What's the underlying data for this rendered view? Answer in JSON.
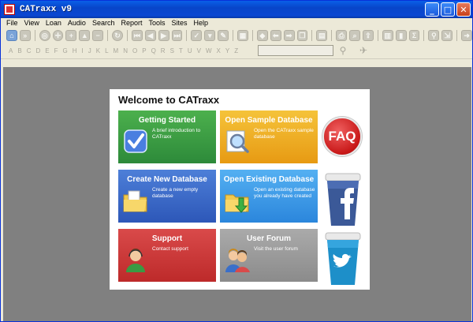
{
  "window": {
    "title": "CATraxx v9"
  },
  "titlebar_buttons": [
    "_",
    "□",
    "✕"
  ],
  "menu": [
    "File",
    "View",
    "Loan",
    "Audio",
    "Search",
    "Report",
    "Tools",
    "Sites",
    "Help"
  ],
  "alphabet": [
    "A",
    "B",
    "C",
    "D",
    "E",
    "F",
    "G",
    "H",
    "I",
    "J",
    "K",
    "L",
    "M",
    "N",
    "O",
    "P",
    "Q",
    "R",
    "S",
    "T",
    "U",
    "V",
    "W",
    "X",
    "Y",
    "Z"
  ],
  "welcome": {
    "title": "Welcome to CATraxx",
    "tiles": [
      {
        "title": "Getting Started",
        "desc": "A brief introduction to CATraxx"
      },
      {
        "title": "Open Sample Database",
        "desc": "Open the CATraxx sample database"
      },
      {
        "title": "Create New Database",
        "desc": "Create a new empty database"
      },
      {
        "title": "Open Existing Database",
        "desc": "Open an existing database you already have created"
      },
      {
        "title": "Support",
        "desc": "Contact support"
      },
      {
        "title": "User Forum",
        "desc": "Visit the user forum"
      }
    ],
    "faq_label": "FAQ"
  },
  "colors": {
    "titlebar": "#0a5fe8",
    "workspace": "#808080",
    "tile_green": "#3a9a43",
    "tile_orange": "#efae22",
    "tile_blue": "#3f6cc9",
    "tile_sky": "#3f9be7",
    "tile_red": "#cc3a3a",
    "tile_grey": "#9b9b9b"
  }
}
